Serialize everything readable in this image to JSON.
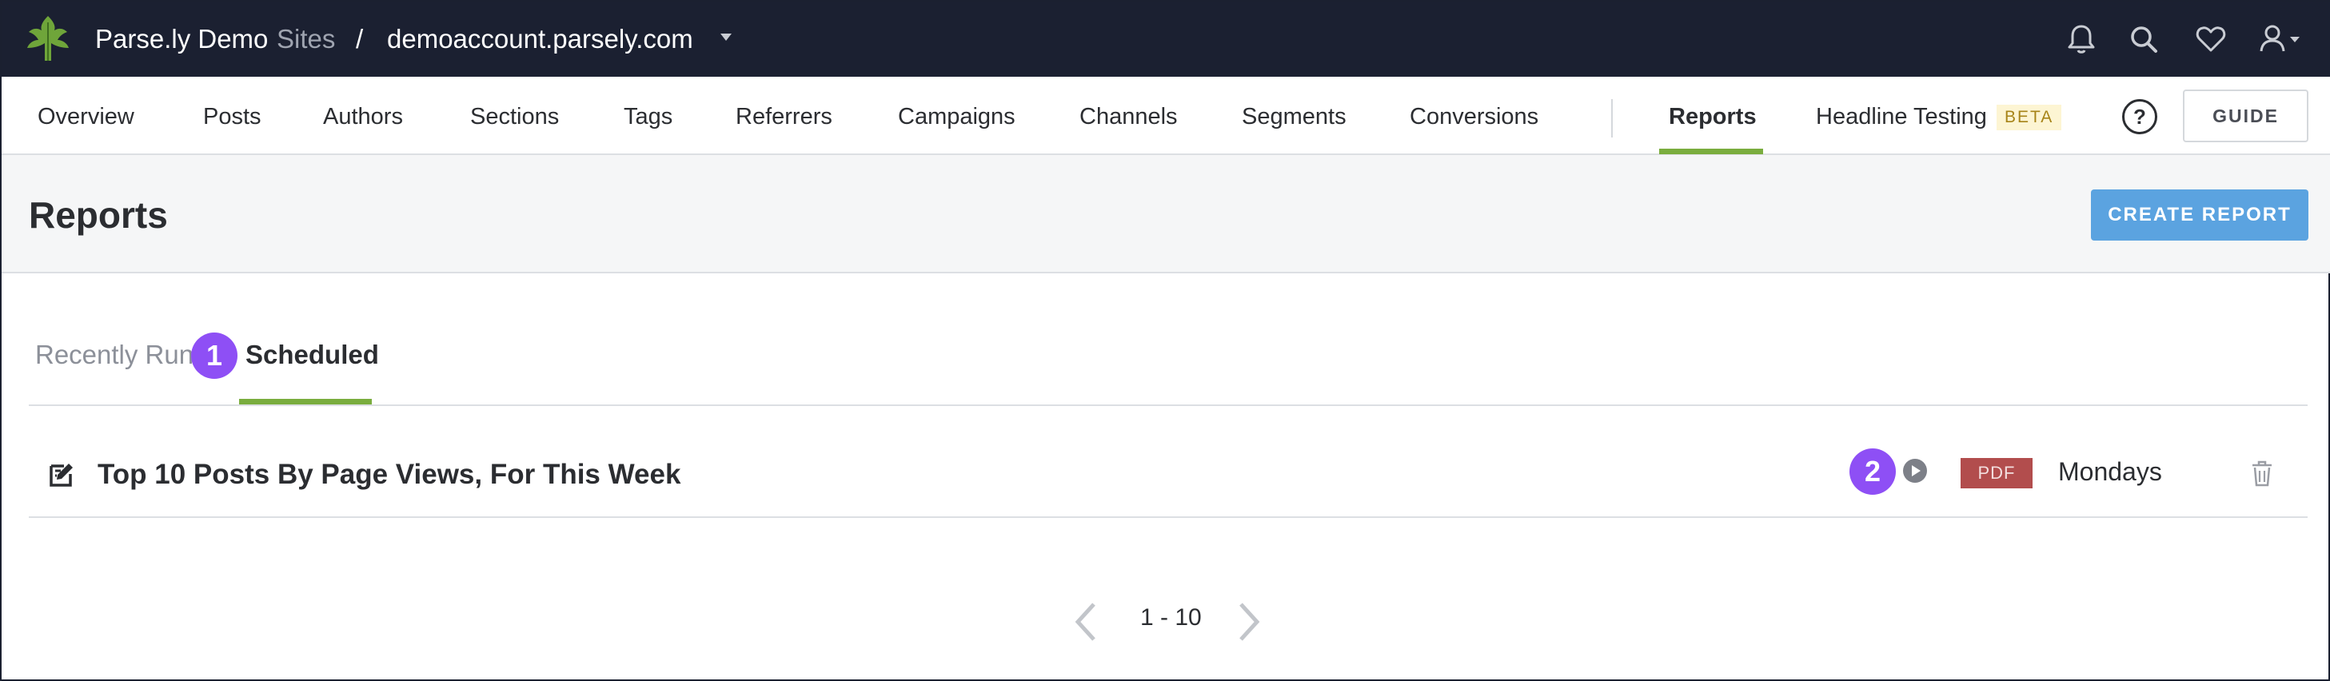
{
  "topbar": {
    "brand": "Parse.ly Demo",
    "sites_link": "Sites",
    "separator": "/",
    "domain": "demoaccount.parsely.com",
    "icons": [
      "leaf-logo",
      "bell-icon",
      "search-icon",
      "heart-icon",
      "user-icon"
    ]
  },
  "nav": {
    "items": [
      {
        "label": "Overview"
      },
      {
        "label": "Posts"
      },
      {
        "label": "Authors"
      },
      {
        "label": "Sections"
      },
      {
        "label": "Tags"
      },
      {
        "label": "Referrers"
      },
      {
        "label": "Campaigns"
      },
      {
        "label": "Channels"
      },
      {
        "label": "Segments"
      },
      {
        "label": "Conversions"
      }
    ],
    "reports": "Reports",
    "headline_testing": "Headline Testing",
    "beta_badge": "BETA",
    "help_symbol": "?",
    "guide": "GUIDE"
  },
  "header": {
    "title": "Reports",
    "create_button": "CREATE REPORT"
  },
  "tabs": {
    "recently_run": "Recently Run",
    "scheduled": "Scheduled",
    "active": "Scheduled"
  },
  "markers": {
    "one": "1",
    "two": "2"
  },
  "reports": [
    {
      "title": "Top 10 Posts By Page Views, For This Week",
      "format": "PDF",
      "frequency": "Mondays"
    }
  ],
  "pagination": {
    "range": "1 - 10"
  },
  "colors": {
    "topbar_bg": "#1b2031",
    "accent_green": "#7aad3e",
    "create_button": "#5ba3e0",
    "pdf_badge": "#b24d4d",
    "marker_purple": "#8e4ff5",
    "beta_bg": "#fdf5d3"
  }
}
